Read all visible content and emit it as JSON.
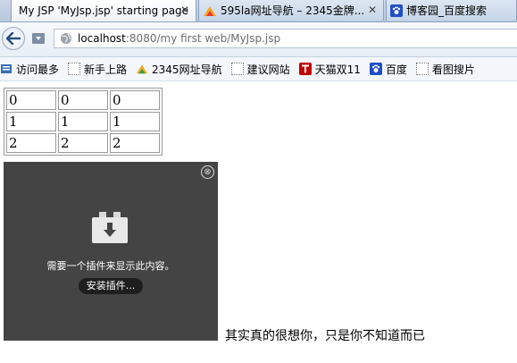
{
  "tabs": [
    {
      "title": "My JSP 'MyJsp.jsp' starting page",
      "close": "✕",
      "active": true
    },
    {
      "title": "595la网址导航 – 2345金牌...",
      "close": "✕",
      "active": false
    },
    {
      "title": "博客园_百度搜索",
      "active": false
    }
  ],
  "address": {
    "host": "localhost",
    "rest": ":8080/my first web/MyJsp.jsp"
  },
  "bookmarks": [
    {
      "label": "访问最多",
      "icon": "bookmarks-folder-icon"
    },
    {
      "label": "新手上路",
      "icon": "page-icon"
    },
    {
      "label": "2345网址导航",
      "icon": "2345-logo-icon"
    },
    {
      "label": "建议网站",
      "icon": "page-icon"
    },
    {
      "label": "天猫双11",
      "icon": "tmall-icon"
    },
    {
      "label": "百度",
      "icon": "baidu-paw-icon"
    },
    {
      "label": "看图搜片",
      "icon": "page-icon"
    }
  ],
  "table": {
    "rows": [
      [
        "0",
        "0",
        "0"
      ],
      [
        "1",
        "1",
        "1"
      ],
      [
        "2",
        "2",
        "2"
      ]
    ]
  },
  "plugin": {
    "message": "需要一个插件来显示此内容。",
    "install_label": "安装插件...",
    "close": "⊗"
  },
  "trailing_text": "其实真的很想你，只是你不知道而已",
  "colors": {
    "tabstrip": "#c3d3e6",
    "plugin_bg": "#444444",
    "tmall_red": "#c40000",
    "baidu_blue": "#1f4fc3"
  }
}
